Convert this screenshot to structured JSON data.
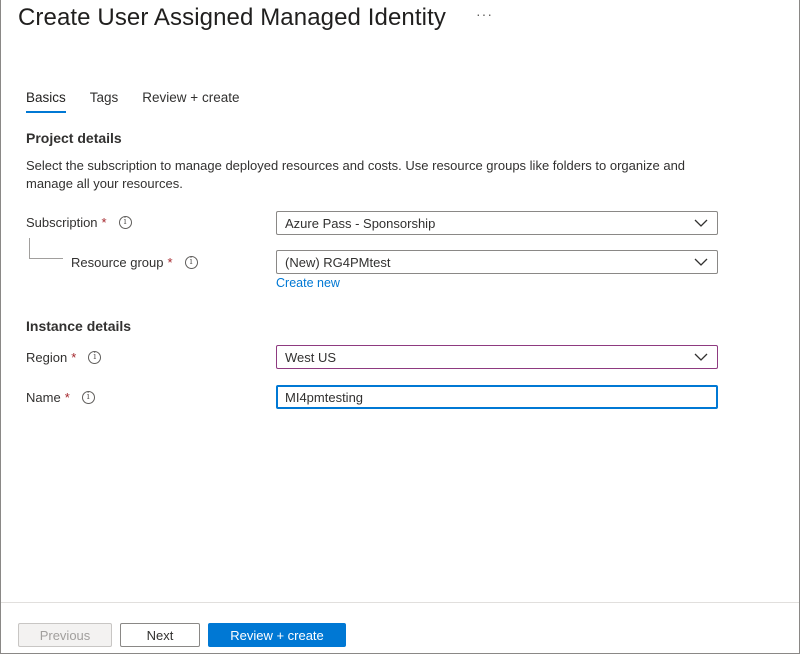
{
  "page": {
    "title": "Create User Assigned Managed Identity",
    "more_label": "···"
  },
  "tabs": [
    {
      "label": "Basics",
      "active": true
    },
    {
      "label": "Tags",
      "active": false
    },
    {
      "label": "Review + create",
      "active": false
    }
  ],
  "project": {
    "heading": "Project details",
    "description": "Select the subscription to manage deployed resources and costs. Use resource groups like folders to organize and manage all your resources.",
    "subscription": {
      "label": "Subscription",
      "required": "*",
      "value": "Azure Pass - Sponsorship"
    },
    "resource_group": {
      "label": "Resource group",
      "required": "*",
      "value": "(New) RG4PMtest",
      "create_new": "Create new"
    }
  },
  "instance": {
    "heading": "Instance details",
    "region": {
      "label": "Region",
      "required": "*",
      "value": "West US"
    },
    "name": {
      "label": "Name",
      "required": "*",
      "value": "MI4pmtesting"
    }
  },
  "footer": {
    "previous": "Previous",
    "next": "Next",
    "review": "Review + create"
  },
  "colors": {
    "accent": "#0078d4",
    "required": "#a4262c",
    "region_border": "#8e3a80"
  },
  "icons": {
    "info": "info-circle-icon",
    "chevron": "chevron-down-icon"
  }
}
